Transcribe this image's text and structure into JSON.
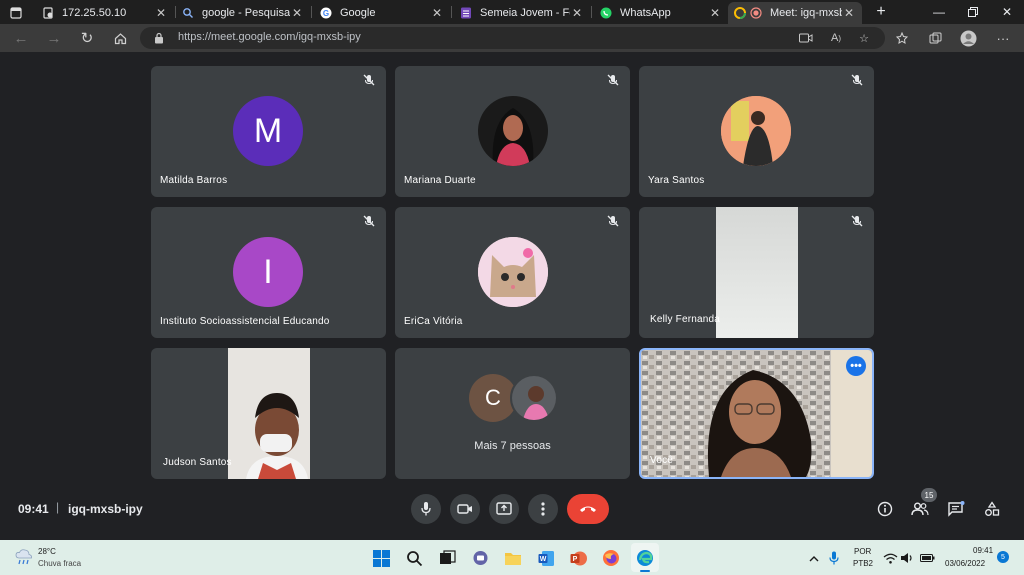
{
  "browser": {
    "tabs": [
      {
        "title": "",
        "icon": "window-icon"
      },
      {
        "title": "172.25.50.10",
        "icon": "page-icon"
      },
      {
        "title": "google - Pesquisar",
        "icon": "search-icon"
      },
      {
        "title": "Google",
        "icon": "google-icon"
      },
      {
        "title": "Semeia Jovem - Formu",
        "icon": "forms-icon"
      },
      {
        "title": "WhatsApp",
        "icon": "whatsapp-icon"
      },
      {
        "title": "Meet: igq-mxsb-",
        "icon": "meet-icon"
      }
    ],
    "url": "https://meet.google.com/igq-mxsb-ipy"
  },
  "meet": {
    "participants": [
      {
        "name": "Matilda Barros",
        "initial": "M",
        "color": "#5b2db9",
        "muted": true
      },
      {
        "name": "Mariana Duarte",
        "initial": "",
        "muted": true
      },
      {
        "name": "Yara Santos",
        "initial": "",
        "muted": true
      },
      {
        "name": "Instituto Socioassistencial Educando",
        "initial": "I",
        "color": "#a848c7",
        "muted": true
      },
      {
        "name": "EriCa Vitória",
        "initial": "",
        "muted": true
      },
      {
        "name": "Kelly Fernanda",
        "initial": "",
        "muted": true
      },
      {
        "name": "Judson Santos",
        "initial": "",
        "muted": false
      },
      {
        "name": "Mais 7 pessoas",
        "initial": "C",
        "color": "#6d5343",
        "muted": false
      },
      {
        "name": "Você",
        "initial": "",
        "muted": false
      }
    ],
    "time": "09:41",
    "separator": "|",
    "meeting_code": "igq-mxsb-ipy",
    "participant_count": "15",
    "accent": "#8ab4f8",
    "end_call_color": "#ea4335"
  },
  "taskbar": {
    "weather_temp": "28°C",
    "weather_desc": "Chuva fraca",
    "lang_top": "POR",
    "lang_bottom": "PTB2",
    "time": "09:41",
    "date": "03/06/2022",
    "notification_count": "5"
  }
}
